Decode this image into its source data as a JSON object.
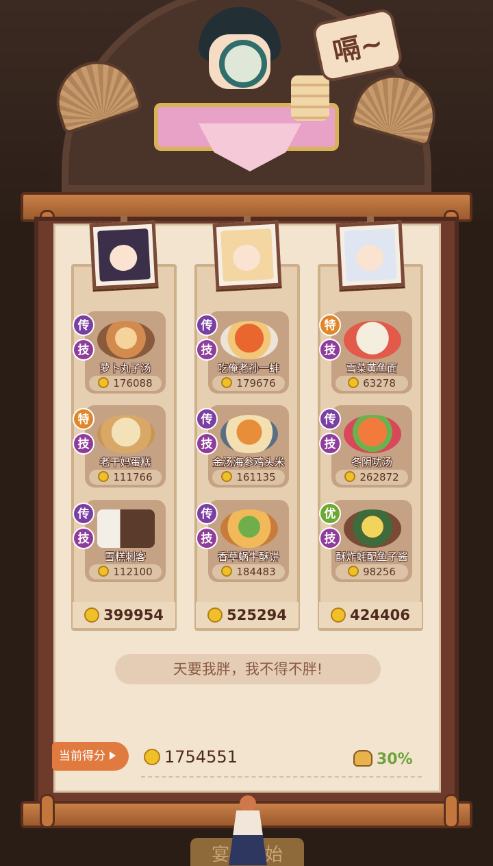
{
  "speech_bubble": "嗝~",
  "columns": [
    {
      "total": "399954",
      "dishes": [
        {
          "rank_badge": "传",
          "skill_badge": "技",
          "name": "萝卜丸子汤",
          "score": "176088"
        },
        {
          "rank_badge": "特",
          "skill_badge": "技",
          "name": "老干妈蛋糕",
          "score": "111766"
        },
        {
          "rank_badge": "传",
          "skill_badge": "技",
          "name": "雪糕刺客",
          "score": "112100"
        }
      ]
    },
    {
      "total": "525294",
      "dishes": [
        {
          "rank_badge": "传",
          "skill_badge": "技",
          "name": "吃俺老孙一蚌",
          "score": "179676"
        },
        {
          "rank_badge": "传",
          "skill_badge": "技",
          "name": "金汤海参鸡头米",
          "score": "161135"
        },
        {
          "rank_badge": "传",
          "skill_badge": "技",
          "name": "香草蜗牛酥饼",
          "score": "184483"
        }
      ]
    },
    {
      "total": "424406",
      "dishes": [
        {
          "rank_badge": "特",
          "skill_badge": "技",
          "name": "雪菜黄鱼面",
          "score": "63278"
        },
        {
          "rank_badge": "传",
          "skill_badge": "技",
          "name": "冬阴功汤",
          "score": "262872"
        },
        {
          "rank_badge": "优",
          "skill_badge": "技",
          "name": "酥炸蚝配鱼子酱",
          "score": "98256"
        }
      ]
    }
  ],
  "slogan": "天要我胖，我不得不胖!",
  "score_label": "当前得分",
  "score_value": "1754551",
  "bonus_percent": "30%",
  "start_button": "宴会开始",
  "colors": {
    "legend_badge": "#7b3fa4",
    "special_badge": "#e1872a",
    "good_badge": "#6da834",
    "accent": "#e07a3e"
  }
}
